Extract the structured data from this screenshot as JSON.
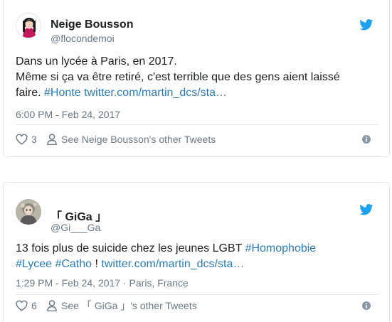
{
  "tweets": [
    {
      "name": "Neige Bousson",
      "handle": "@flocondemoi",
      "text_line1": "Dans un lycée à Paris, en 2017.",
      "text_line2": "Même si ça va être retiré, c'est terrible que des gens aient laissé",
      "text_line3_pre": "faire. ",
      "hashtag": "#Honte",
      "link": "twitter.com/martin_dcs/sta…",
      "timestamp": "6:00 PM - Feb 24, 2017",
      "likes": "3",
      "other_tweets": "See Neige Bousson's other Tweets"
    },
    {
      "name": "「 GiGa 」",
      "handle": "@Gi___Ga",
      "text_line1_pre": "13 fois plus de suicide chez les jeunes LGBT ",
      "hashtag1": "#Homophobie",
      "hashtag2": "#Lycee",
      "hashtag3": "#Catho",
      "text_sep": " ! ",
      "link": "twitter.com/martin_dcs/sta…",
      "timestamp": "1:29 PM - Feb 24, 2017 · Paris, France",
      "likes": "6",
      "other_tweets": "See 「 GiGa 」's other Tweets"
    }
  ],
  "colors": {
    "link": "#2b7bb9",
    "twitter_blue": "#1da1f2",
    "muted": "#697882",
    "text": "#1c2022",
    "border": "#e1e8ed"
  },
  "icons": [
    "twitter-bird-icon",
    "heart-icon",
    "person-icon",
    "info-icon"
  ]
}
